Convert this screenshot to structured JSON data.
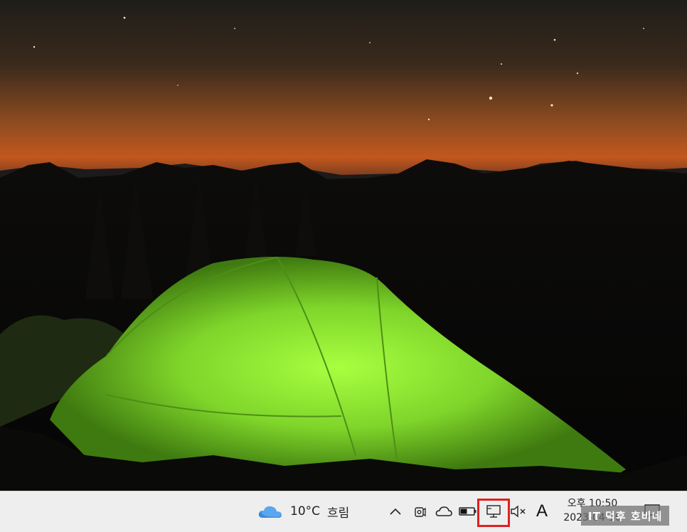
{
  "taskbar": {
    "weather": {
      "icon": "cloud-icon",
      "temperature": "10°C",
      "condition": "흐림"
    },
    "tray": {
      "show_hidden_icon": "chevron-up-icon",
      "icons": [
        "camera-icon",
        "onedrive-cloud-icon",
        "battery-icon",
        "network-monitor-icon",
        "speaker-muted-icon"
      ],
      "highlighted_icon": "network-monitor-icon"
    },
    "input_indicator": "A",
    "clock": {
      "time": "오후 10:50",
      "date": "2023-04-16"
    },
    "watermark": "IT 덕후 호비네"
  },
  "colors": {
    "highlight": "#e02020",
    "tent": "#7fd52a",
    "taskbar": "#eeeeee"
  }
}
